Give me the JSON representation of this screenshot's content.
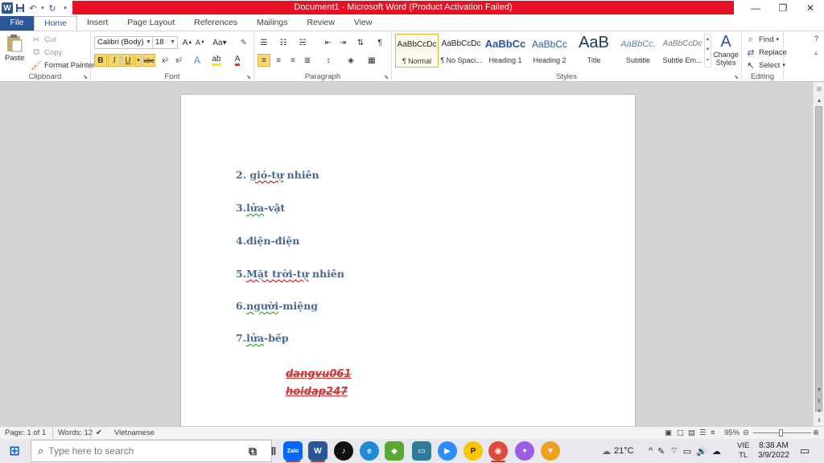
{
  "window": {
    "title": "Document1 - Microsoft Word (Product Activation Failed)",
    "logo_letter": "W"
  },
  "tabs": [
    "File",
    "Home",
    "Insert",
    "Page Layout",
    "References",
    "Mailings",
    "Review",
    "View"
  ],
  "clipboard": {
    "paste": "Paste",
    "cut": "Cut",
    "copy": "Copy",
    "format_painter": "Format Painter",
    "label": "Clipboard"
  },
  "font": {
    "name": "Calibri (Body)",
    "size": "18",
    "label": "Font"
  },
  "paragraph": {
    "label": "Paragraph"
  },
  "styles": {
    "label": "Styles",
    "items": [
      {
        "sample": "AaBbCcDc",
        "name": "¶ Normal"
      },
      {
        "sample": "AaBbCcDc",
        "name": "¶ No Spaci..."
      },
      {
        "sample": "AaBbCc",
        "name": "Heading 1"
      },
      {
        "sample": "AaBbCc",
        "name": "Heading 2"
      },
      {
        "sample": "AaB",
        "name": "Title"
      },
      {
        "sample": "AaBbCc.",
        "name": "Subtitle"
      },
      {
        "sample": "AaBbCcDc",
        "name": "Subtle Em..."
      }
    ],
    "change_styles": "Change Styles"
  },
  "editing": {
    "find": "Find",
    "replace": "Replace",
    "select": "Select",
    "label": "Editing"
  },
  "document": {
    "lines": [
      {
        "num": "2. ",
        "a": "gió-tự",
        "b": " nhiên"
      },
      {
        "num": "3.",
        "a": "lửa",
        "b": "-vật"
      },
      {
        "num": "4.",
        "a": "điện-điện",
        "b": ""
      },
      {
        "num": "5.",
        "a": "Mặt trời-tự",
        "b": " nhiên"
      },
      {
        "num": "6.",
        "a": "người",
        "b": "-miệng"
      },
      {
        "num": "7.",
        "a": "lửa",
        "b": "-bếp"
      }
    ],
    "struck": [
      "dangvu061",
      "hoidap247"
    ]
  },
  "status": {
    "page": "Page: 1 of 1",
    "words": "Words: 12",
    "language": "Vietnamese",
    "zoom": "95%"
  },
  "taskbar": {
    "search_placeholder": "Type here to search",
    "weather": "21°C",
    "lang_top": "VIE",
    "lang_bottom": "TL",
    "time": "8:38 AM",
    "date": "3/9/2022",
    "app_zalo": "Zalo"
  },
  "colors": {
    "accent": "#2b579a",
    "title_bar": "#e81123",
    "doc_text": "#4a6691",
    "strike_text": "#e03030"
  }
}
